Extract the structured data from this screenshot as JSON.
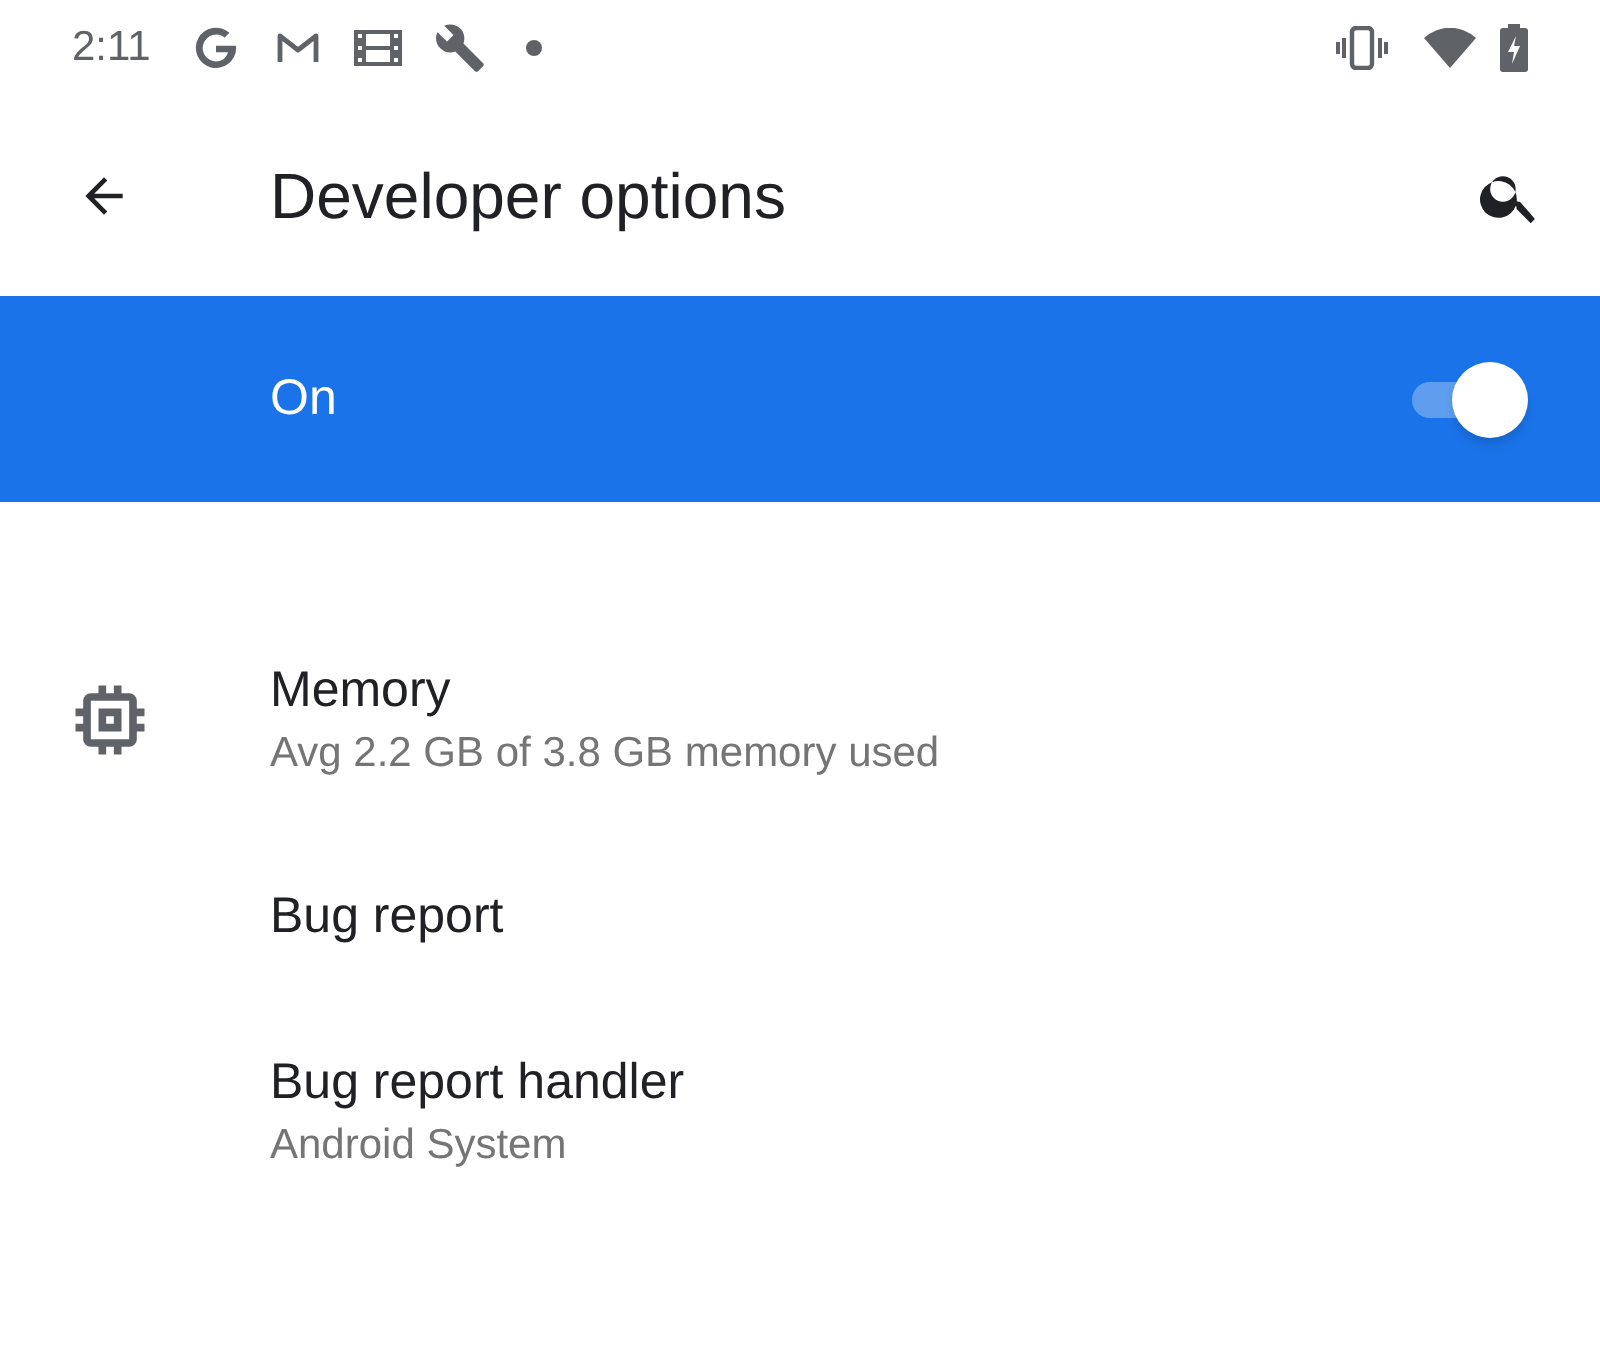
{
  "status_bar": {
    "time": "2:11"
  },
  "app_bar": {
    "title": "Developer options"
  },
  "main_switch": {
    "label": "On",
    "on": true
  },
  "items": [
    {
      "kind": "icon",
      "title": "Memory",
      "summary": "Avg 2.2 GB of 3.8 GB memory used"
    },
    {
      "kind": "plain",
      "title": "Bug report"
    },
    {
      "kind": "plain",
      "title": "Bug report handler",
      "summary": "Android System"
    }
  ]
}
